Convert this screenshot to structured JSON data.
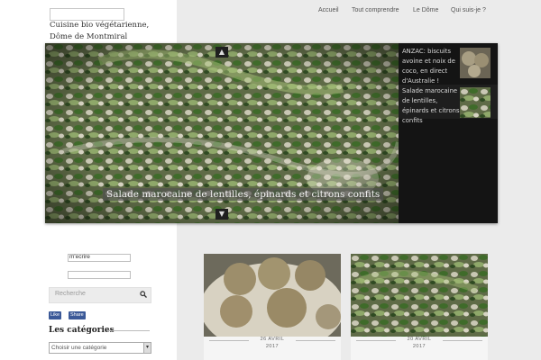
{
  "site": {
    "description": "Cuisine bio végétarienne, Dôme de Montmiral"
  },
  "nav": {
    "items": [
      {
        "label": "Accueil"
      },
      {
        "label": "Tout comprendre"
      },
      {
        "label": "Le Dôme"
      },
      {
        "label": "Qui suis-je ?"
      }
    ]
  },
  "slider": {
    "caption": "Salade marocaine de lentilles, épinards et citrons confits",
    "prev_icon": "▲",
    "next_icon": "▼",
    "thumbs": [
      {
        "title": "ANZAC: biscuits avoine et noix de coco, en direct d'Australie !"
      },
      {
        "title": "Salade marocaine de lentilles, épinards et citrons confits"
      }
    ]
  },
  "sidebar": {
    "email_label": "m'ecrire",
    "search_placeholder": "Recherche",
    "search_icon": "search-icon",
    "fb_like": "Like",
    "fb_share": "Share",
    "categories_title": "Les catégories",
    "categories_select": "Choisir une catégorie"
  },
  "posts": [
    {
      "date_line1": "26 AVRIL",
      "date_line2": "2017"
    },
    {
      "date_line1": "20 AVRIL",
      "date_line2": "2017"
    }
  ],
  "colors": {
    "background": "#e9e9e9",
    "sidebar_bg": "#ffffff",
    "slider_bg": "#141414",
    "facebook": "#3b5998"
  }
}
